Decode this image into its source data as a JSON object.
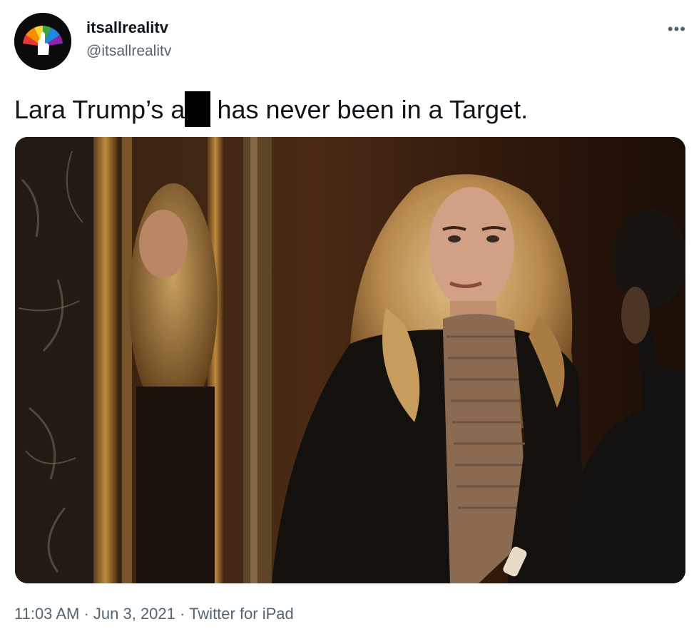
{
  "tweet": {
    "display_name": "itsallrealitv",
    "handle": "@itsallrealitv",
    "text_before": "Lara Trump’s a",
    "text_after": "has never been in a Target.",
    "more_icon": "ellipsis-icon"
  },
  "meta": {
    "time": "11:03 AM",
    "separator": "·",
    "date": "Jun 3, 2021",
    "source": "Twitter for iPad"
  },
  "icons": {
    "avatar": "peacock-logo",
    "photo": "woman-in-elevator-photo"
  },
  "colors": {
    "text": "#0f1419",
    "secondary": "#536471",
    "background": "#ffffff"
  }
}
